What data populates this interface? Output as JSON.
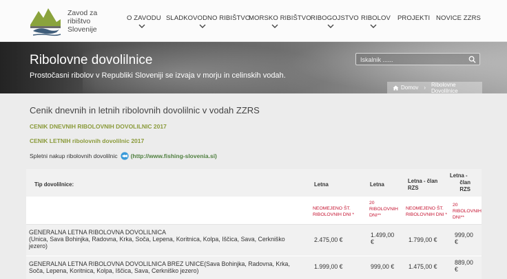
{
  "header": {
    "logo_line1": "Zavod za",
    "logo_line2": "ribištvo",
    "logo_line3": "Slovenije",
    "nav": [
      {
        "label": "O ZAVODU",
        "has_dropdown": true
      },
      {
        "label": "SLADKOVODNO RIBIŠTVO",
        "has_dropdown": true
      },
      {
        "label": "MORSKO RIBIŠTVO",
        "has_dropdown": true
      },
      {
        "label": "RIBOGOJSTVO",
        "has_dropdown": true
      },
      {
        "label": "RIBOLOV",
        "has_dropdown": true
      },
      {
        "label": "PROJEKTI",
        "has_dropdown": false
      },
      {
        "label": "NOVICE ZZRS",
        "has_dropdown": false
      }
    ]
  },
  "banner": {
    "title": "Ribolovne dovolilnice",
    "subtitle": "Prostočasni ribolov v Republiki Sloveniji se izvaja v morju in celinskih vodah.",
    "search_placeholder": "Iskalnik ......",
    "breadcrumb_home": "Domov",
    "breadcrumb_current": "Ribolovne Dovolilnice"
  },
  "content": {
    "heading": "Cenik dnevnih in letnih ribolovnih dovolilnic v vodah ZZRS",
    "link_daily": "CENIK DNEVNIH RIBOLOVNIH DOVOLILNIC 2017",
    "link_annual": "CENIK LETNIH ribolovnih dovolilnic 2017",
    "buy_text": "Spletni nakup ribolovnih dovolilnic",
    "buy_url": "(http://www.fishing-slovenia.si)"
  },
  "table": {
    "headers": {
      "type": "Tip dovolilnice:",
      "col1": "Letna",
      "col2": "Letna",
      "col3_line1": "Letna - član",
      "col3_line2": "RZS",
      "col4_line1": "Letna -",
      "col4_line2": "član",
      "col4_line3": "RZS"
    },
    "subheaders": {
      "col1_line1": "NEOMEJENO ŠT.",
      "col1_line2": "RIBOLOVNIH DNI *",
      "col2_line1": "20",
      "col2_line2": "RIBOLOVNIH",
      "col2_line3": "DNI**",
      "col3_line1": "NEOMEJENO ŠT.",
      "col3_line2": "RIBOLOVNIH DNI *",
      "col4_line1": "20",
      "col4_line2": "RIBOLOVNIH",
      "col4_line3": "DNI**"
    },
    "rows": [
      {
        "name_line1": "GENERALNA LETNA RIBOLOVNA DOVOLILNICA",
        "name_line2": "(Unica, Sava Bohinjka, Radovna, Krka, Soča, Lepena, Koritnica, Kolpa, Iščica, Sava, Cerkniško",
        "name_line3": "jezero)",
        "v1": "2.475,00 €",
        "v2_line1": "1.499,00",
        "v2_line2": "€",
        "v3": "1.799,00 €",
        "v4_line1": "999,00",
        "v4_line2": "€"
      },
      {
        "name_line1": "GENERALNA LETNA RIBOLOVNA DOVOLILNICA BREZ UNICE(Sava Bohinjka, Radovna, Krka,",
        "name_line2": "Soča, Lepena, Koritnica, Kolpa, Iščica, Sava, Cerkniško jezero)",
        "v1": "1.999,00 €",
        "v2": "999,00 €",
        "v3": "1.475,00 €",
        "v4_line1": "889,00",
        "v4_line2": "€"
      }
    ]
  },
  "colors": {
    "accent_green": "#8a9a3a",
    "url_green": "#4f7f3f",
    "red": "#c4102e"
  }
}
